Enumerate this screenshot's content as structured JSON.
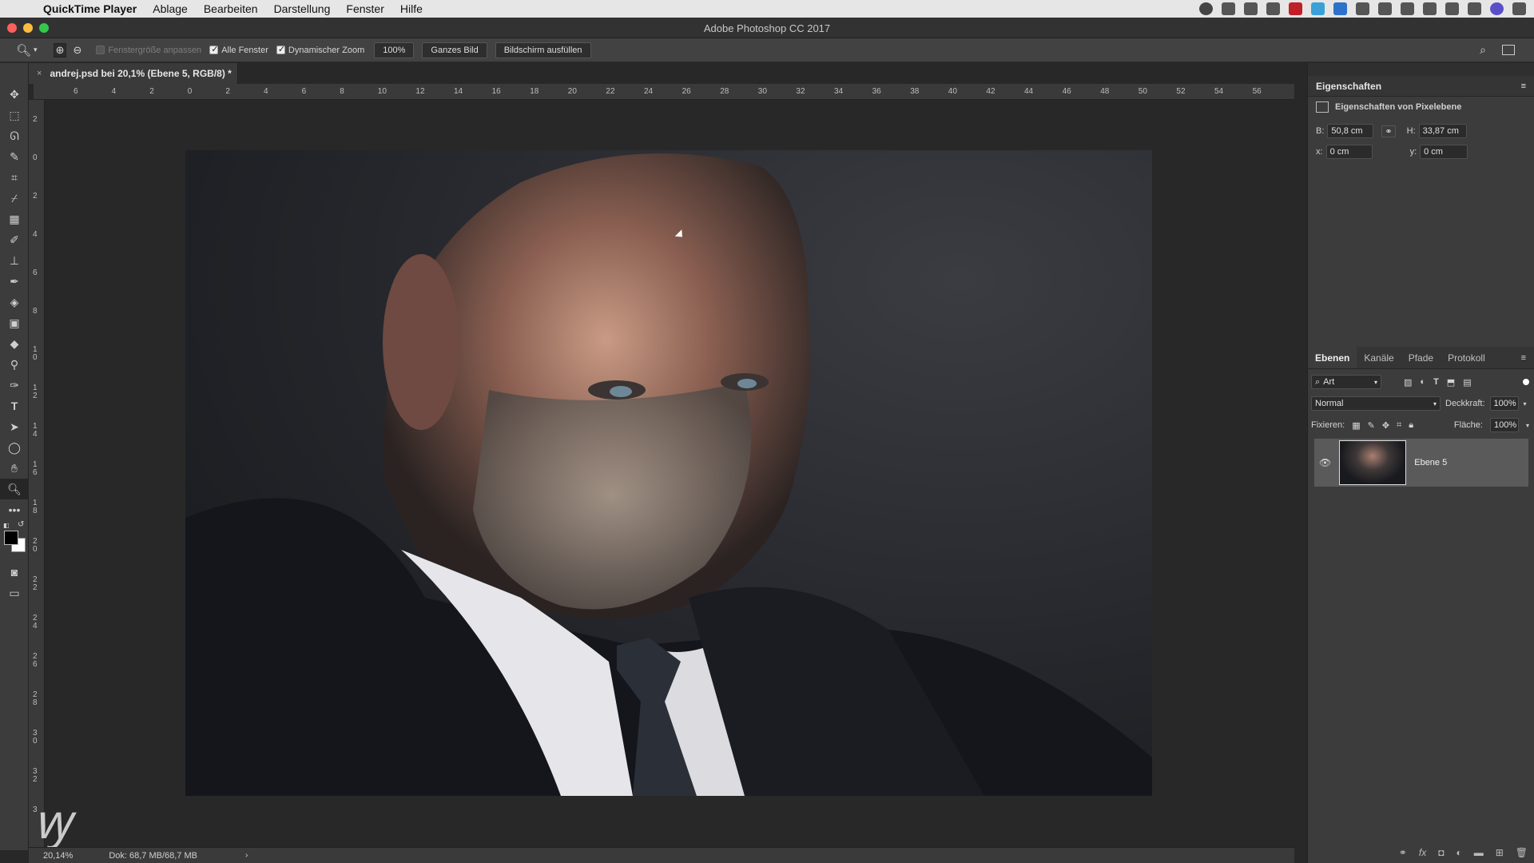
{
  "menubar": {
    "app_name": "QuickTime Player",
    "items": [
      "Ablage",
      "Bearbeiten",
      "Darstellung",
      "Fenster",
      "Hilfe"
    ]
  },
  "window": {
    "title": "Adobe Photoshop CC 2017"
  },
  "options_bar": {
    "fit_window_label": "Fenstergröße anpassen",
    "all_windows_label": "Alle Fenster",
    "dynamic_zoom_label": "Dynamischer Zoom",
    "zoom_value": "100%",
    "fit_screen_label": "Ganzes Bild",
    "fill_screen_label": "Bildschirm ausfüllen"
  },
  "document": {
    "tab_title": "andrej.psd bei 20,1% (Ebene 5, RGB/8) *"
  },
  "ruler": {
    "top_labels": [
      "6",
      "4",
      "2",
      "0",
      "2",
      "4",
      "6",
      "8",
      "10",
      "12",
      "14",
      "16",
      "18",
      "20",
      "22",
      "24",
      "26",
      "28",
      "30",
      "32",
      "34",
      "36",
      "38",
      "40",
      "42",
      "44",
      "46",
      "48",
      "50",
      "52",
      "54",
      "56"
    ],
    "left_labels": [
      "2",
      "0",
      "2",
      "4",
      "6",
      "8",
      "1 0",
      "1 2",
      "1 4",
      "1 6",
      "1 8",
      "2 0",
      "2 2",
      "2 4",
      "2 6",
      "2 8",
      "3 0",
      "3 2",
      "3"
    ]
  },
  "status": {
    "zoom": "20,14%",
    "doc_size": "Dok: 68,7 MB/68,7 MB"
  },
  "properties": {
    "title": "Eigenschaften",
    "subtitle": "Eigenschaften von Pixelebene",
    "w_label": "B:",
    "w_value": "50,8 cm",
    "h_label": "H:",
    "h_value": "33,87 cm",
    "x_label": "x:",
    "x_value": "0 cm",
    "y_label": "y:",
    "y_value": "0 cm"
  },
  "layers_panel": {
    "tabs": [
      "Ebenen",
      "Kanäle",
      "Pfade",
      "Protokoll"
    ],
    "filter_label": "Art",
    "blend_mode": "Normal",
    "opacity_label": "Deckkraft:",
    "opacity_value": "100%",
    "lock_label": "Fixieren:",
    "fill_label": "Fläche:",
    "fill_value": "100%",
    "layers": [
      {
        "name": "Ebene 5"
      }
    ]
  },
  "colors": {
    "accent": "#2d8cf0",
    "chrome": "#3c3c3c",
    "canvas_bg": "#282828"
  }
}
